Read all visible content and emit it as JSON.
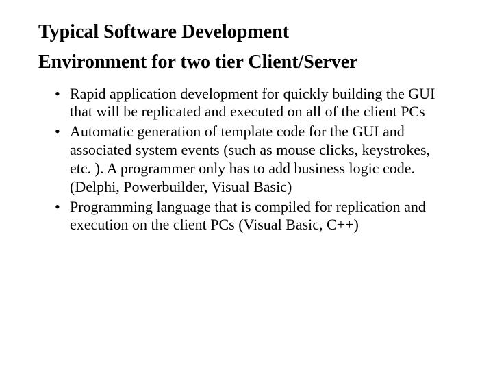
{
  "heading": {
    "line1": "Typical Software Development",
    "line2": "Environment for two tier Client/Server"
  },
  "bullets": [
    "Rapid application development for quickly building the GUI that will be replicated and executed on all of the client PCs",
    "Automatic generation of template code for the GUI and associated system events (such as mouse clicks, keystrokes, etc. ).  A programmer only has to add business logic code.  (Delphi, Powerbuilder, Visual Basic)",
    "Programming language that is compiled for replication and execution on the client PCs (Visual Basic, C++)"
  ]
}
